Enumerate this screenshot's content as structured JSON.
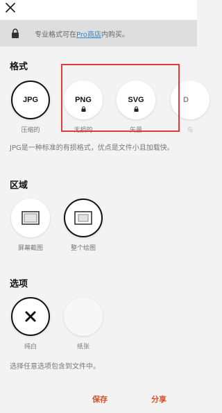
{
  "banner": {
    "prefix": "专业格式可在",
    "link": "Pro商店",
    "suffix": "内购买。"
  },
  "format": {
    "title": "格式",
    "options": [
      {
        "label": "JPG",
        "caption": "压缩的"
      },
      {
        "label": "PNG",
        "caption": "无损的"
      },
      {
        "label": "SVG",
        "caption": "矢量"
      },
      {
        "label": "D",
        "caption": "与"
      }
    ],
    "selected": "JPG",
    "description": "JPG是一种标准的有损格式，优点是文件小且加载快。"
  },
  "region": {
    "title": "区域",
    "options": [
      {
        "caption": "屏幕截图"
      },
      {
        "caption": "整个绘图"
      }
    ],
    "selected": "整个绘图"
  },
  "options": {
    "title": "选项",
    "items": [
      {
        "caption": "纯白"
      },
      {
        "caption": "纸张"
      }
    ],
    "description": "选择任意选项包含到文件中。"
  },
  "actions": {
    "save": "保存",
    "share": "分享"
  },
  "colors": {
    "accent": "#d8502a",
    "link": "#2e86d1",
    "highlight": "#e03a3a"
  }
}
